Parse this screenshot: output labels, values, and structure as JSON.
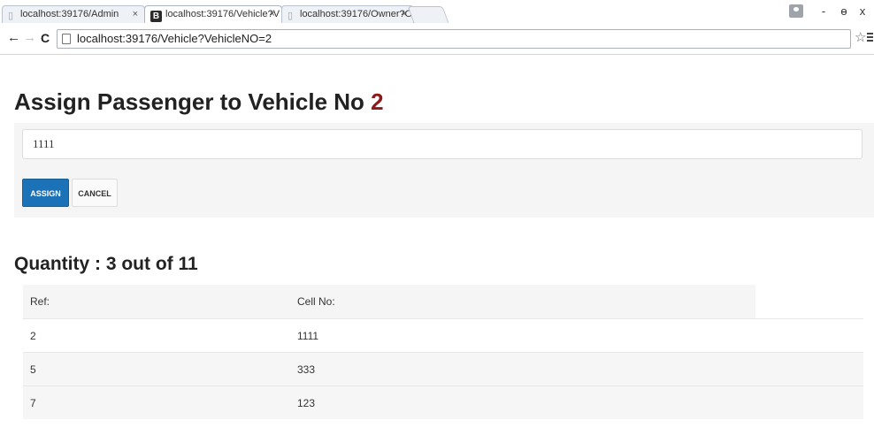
{
  "browser": {
    "tabs": [
      {
        "label": "localhost:39176/Admin",
        "close": "×",
        "active": false
      },
      {
        "label": "localhost:39176/Vehicle?V",
        "close": "×",
        "active": true,
        "favicon_letter": "B"
      },
      {
        "label": "localhost:39176/Owner?O",
        "close": "×",
        "active": false
      }
    ],
    "url": "localhost:39176/Vehicle?VehicleNO=2",
    "icons": {
      "back": "←",
      "forward": "→",
      "reload": "C",
      "star": "☆",
      "minimize": "-",
      "maximize": "ɵ",
      "close": "x"
    }
  },
  "page": {
    "title_prefix": "Assign Passenger to Vehicle No ",
    "vehicle_no": "2",
    "input_value": "1111",
    "assign_label": "ASSIGN",
    "cancel_label": "CANCEL",
    "quantity_text": "Quantity : 3 out of 11",
    "table": {
      "headers": [
        "Ref:",
        "Cell No:"
      ],
      "rows": [
        {
          "ref": "2",
          "cell": "1111"
        },
        {
          "ref": "5",
          "cell": "333"
        },
        {
          "ref": "7",
          "cell": "123"
        }
      ]
    }
  },
  "colors": {
    "primary_button": "#1c72b7",
    "vehicle_number": "#8b1a1a",
    "well_background": "#f5f5f5"
  }
}
